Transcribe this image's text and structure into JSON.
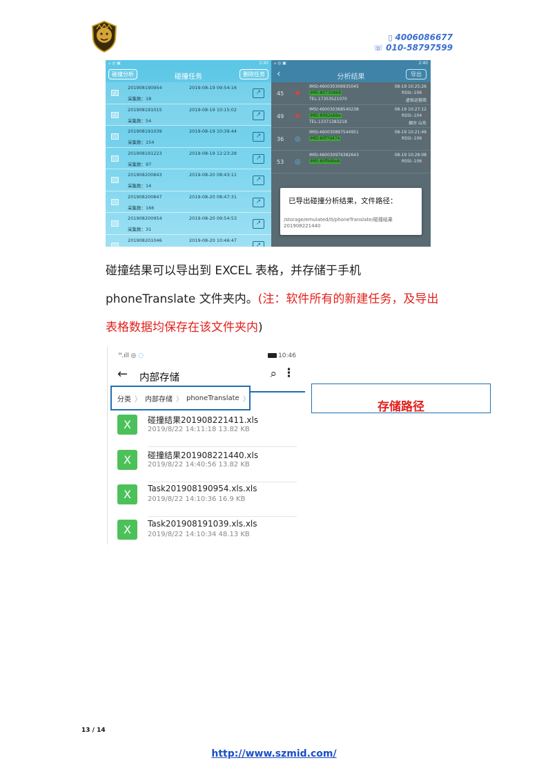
{
  "header": {
    "phone1": "4006086677",
    "phone2": "010-58797599",
    "phone_icon_name": "mobile-phone-icon",
    "landline_icon_name": "telephone-icon"
  },
  "task_screen": {
    "status_time": "2:40",
    "left_button": "碰撞分析",
    "title": "碰撞任务",
    "right_button": "删除任务",
    "count_label": "采集数：",
    "tasks": [
      {
        "id": "201908190954",
        "datetime": "2019-08-19 09:54:16",
        "count": "18",
        "checked": true
      },
      {
        "id": "201908191015",
        "datetime": "2019-08-19 10:15:02",
        "count": "54",
        "checked": true
      },
      {
        "id": "201908191039",
        "datetime": "2019-08-19 10:39:44",
        "count": "154",
        "checked": false
      },
      {
        "id": "201908191223",
        "datetime": "2019-08-19 12:23:28",
        "count": "97",
        "checked": false
      },
      {
        "id": "201908200843",
        "datetime": "2019-08-20 08:43:11",
        "count": "14",
        "checked": false
      },
      {
        "id": "201908200847",
        "datetime": "2019-08-20 08:47:31",
        "count": "166",
        "checked": false
      },
      {
        "id": "201908200954",
        "datetime": "2019-08-20 09:54:53",
        "count": "31",
        "checked": false
      },
      {
        "id": "201908201046",
        "datetime": "2019-08-20 10:46:47",
        "count": "",
        "checked": false
      }
    ]
  },
  "result_screen": {
    "status_time": "2:40",
    "title": "分析结果",
    "export_button": "导出",
    "rows": [
      {
        "num": "45",
        "imsi": "IMSI:460030306935045",
        "imei": "IMEI:80730868",
        "tel": "TEL:17353521070",
        "time": "08-19 10:25:26",
        "rssi": "RSSI:-106",
        "flag": "1",
        "loc": "虚拟运营商"
      },
      {
        "num": "49",
        "imsi": "IMSI:460030368540238",
        "imei": "IMEI:8062ebbe",
        "tel": "TEL:13371383218",
        "time": "08-19 10:27:12",
        "rssi": "RSSI:-104",
        "flag": "1",
        "loc": "烟台 山东"
      },
      {
        "num": "36",
        "imsi": "IMSI:460030897544951",
        "imei": "IMEI:80f7d474",
        "tel": "",
        "time": "08-19 10:21:49",
        "rssi": "RSSI:-106",
        "flag": "1",
        "loc": ""
      },
      {
        "num": "53",
        "imsi": "IMSI:460030976382643",
        "imei": "IMEI:80f9d9e8",
        "tel": "",
        "time": "08-19 10:28:08",
        "rssi": "RSSI:-106",
        "flag": "1",
        "loc": ""
      }
    ],
    "dialog_message": "已导出碰撞分析结果，文件路径：",
    "dialog_path": "/storage/emulated/0/phoneTranslate/碰撞结果201908221440"
  },
  "paragraph": {
    "line1": "碰撞结果可以导出到 EXCEL 表格，并存储于手机",
    "line2_black": "phoneTranslate 文件夹内。",
    "line2_red": "(注：软件所有的新建任务，及导出",
    "line3_red": "表格数据均保存在该文件夹内",
    "line3_black": ")"
  },
  "storage_screen": {
    "status_time": "10:46",
    "title": "内部存储",
    "breadcrumb": [
      "分类",
      "内部存储",
      "phoneTranslate"
    ],
    "files": [
      {
        "name": "碰撞结果201908221411.xls",
        "meta": "2019/8/22 14:11:18 13.82 KB"
      },
      {
        "name": "碰撞结果201908221440.xls",
        "meta": "2019/8/22 14:40:56 13.82 KB"
      },
      {
        "name": "Task201908190954.xls.xls",
        "meta": "2019/8/22 14:10:36 16.9 KB"
      },
      {
        "name": "Task201908191039.xls.xls",
        "meta": "2019/8/22 14:10:34 48.13 KB"
      }
    ],
    "file_icon_letter": "X"
  },
  "callout": {
    "label": "存储路径",
    "color": "#e2201c",
    "border_color": "#1f6fae"
  },
  "footer": {
    "page": "13 / 14",
    "url": "http://www.szmid.com/"
  }
}
